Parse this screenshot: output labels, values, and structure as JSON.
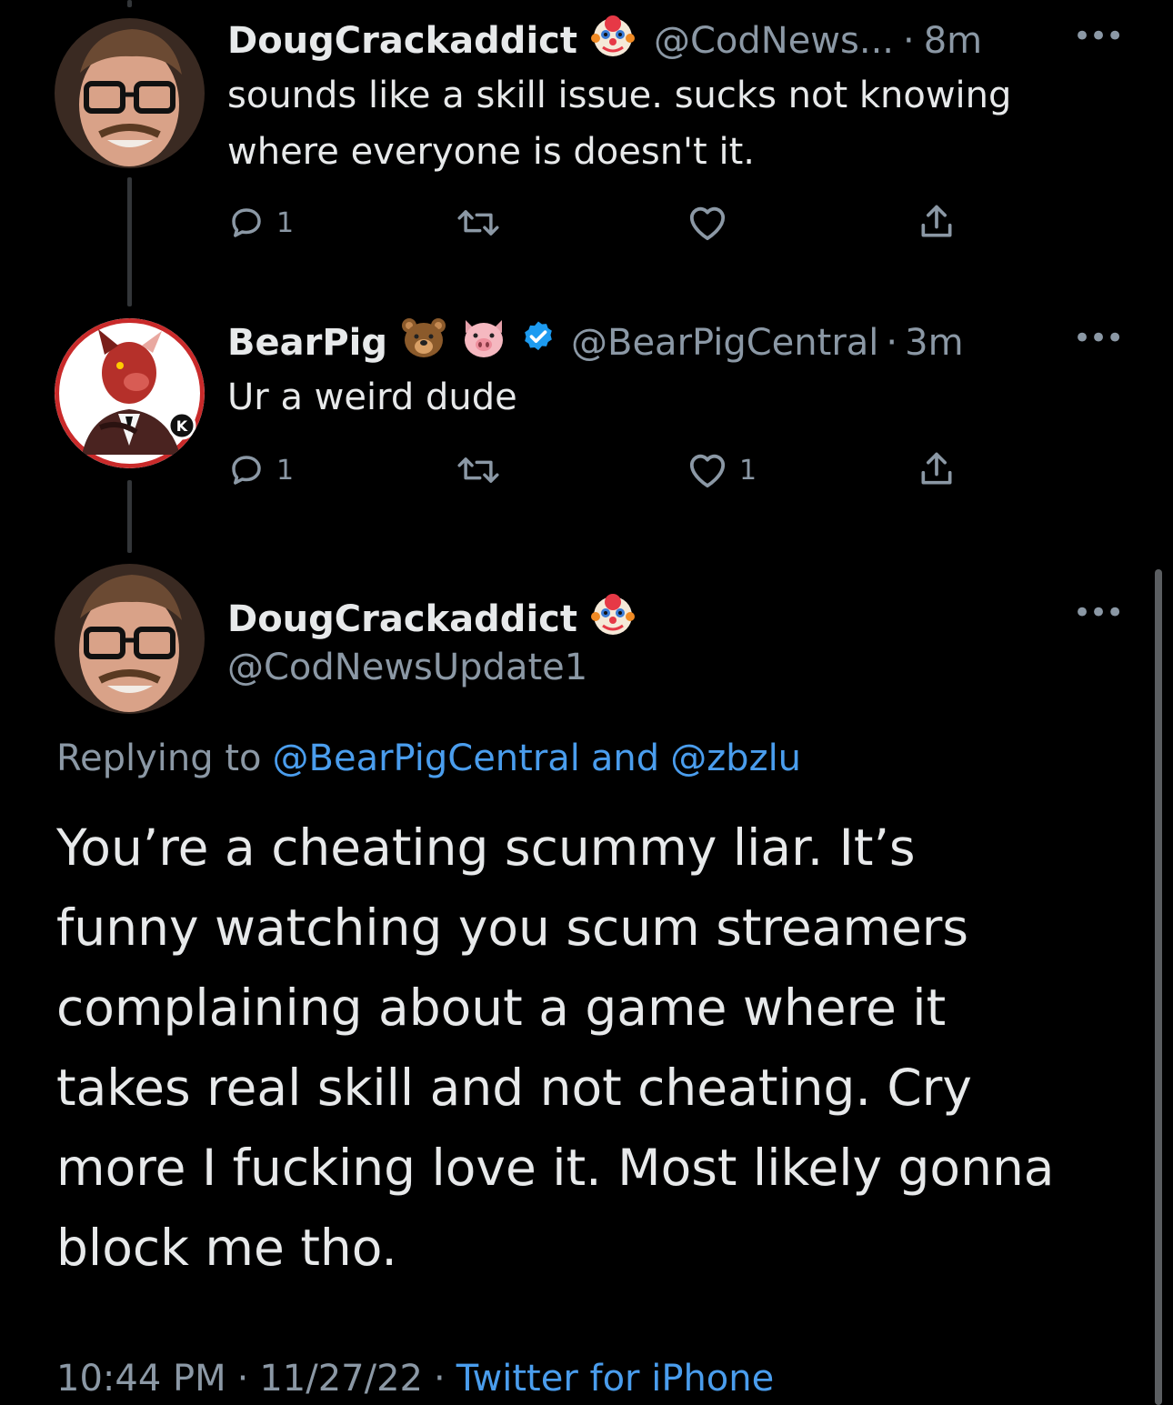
{
  "tweet1": {
    "display_name": "DougCrackaddict",
    "name_emoji": "clown-face",
    "handle": "@CodNews...",
    "time": "8m",
    "text_line1": "sounds like a skill issue. sucks not knowing",
    "text_line2": "where everyone is doesn't it.",
    "reply_count": "1",
    "like_count": ""
  },
  "tweet2": {
    "display_name": "BearPig",
    "name_emojis": [
      "bear-face",
      "pig-face"
    ],
    "verified": true,
    "handle": "@BearPigCentral",
    "time": "3m",
    "text": "Ur a weird dude",
    "reply_count": "1",
    "like_count": "1"
  },
  "main_tweet": {
    "display_name": "DougCrackaddict",
    "name_emoji": "clown-face",
    "handle": "@CodNewsUpdate1",
    "replying_prefix": "Replying to",
    "reply_mention1": "@BearPigCentral",
    "reply_and": "and",
    "reply_mention2": "@zbzlu",
    "text_lines": [
      "You’re a cheating scummy liar. It’s",
      "funny watching you scum streamers",
      "complaining about a game where it",
      "takes real skill and not cheating. Cry",
      "more I fucking love it. Most likely gonna",
      "block me tho."
    ],
    "time": "10:44 PM",
    "date": "11/27/22",
    "source": "Twitter for iPhone"
  },
  "separator": "·",
  "more_glyph": "•••",
  "colors": {
    "background": "#000000",
    "text": "#e7e9ea",
    "secondary": "#8b98a5",
    "link": "#4a9ded",
    "verified": "#1d9bf0"
  }
}
